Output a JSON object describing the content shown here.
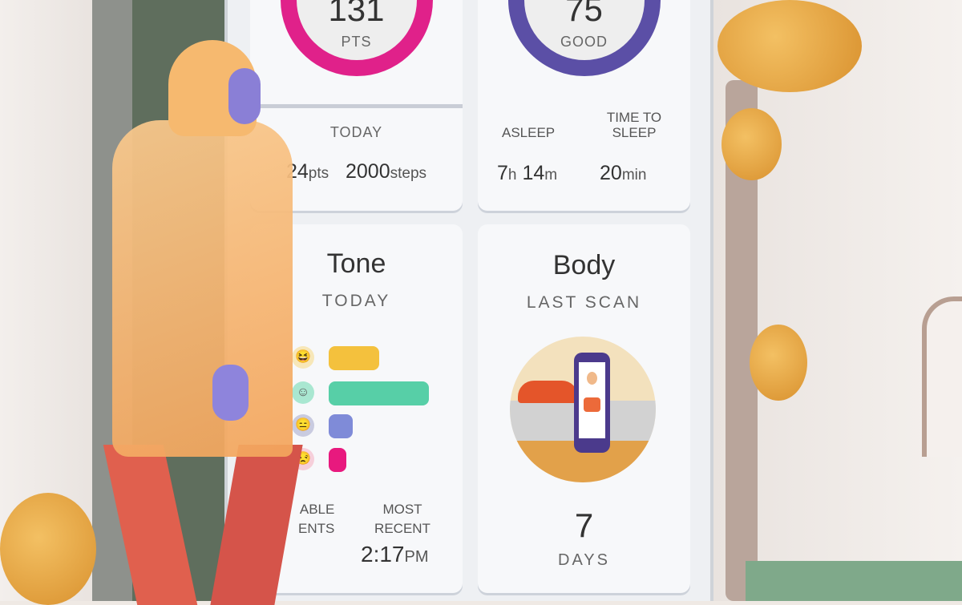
{
  "activity": {
    "score": "131",
    "unit": "PTS",
    "period": "TODAY",
    "pts_value": "24",
    "pts_unit": "pts",
    "steps_value": "2000",
    "steps_unit": "steps",
    "ring_color": "#e0218a"
  },
  "sleep": {
    "score": "75",
    "rating": "GOOD",
    "asleep_label": "ASLEEP",
    "asleep_h": "7",
    "asleep_h_unit": "h",
    "asleep_m": "14",
    "asleep_m_unit": "m",
    "time_to_sleep_label": "TIME TO SLEEP",
    "time_to_sleep_value": "20",
    "time_to_sleep_unit": "min",
    "ring_color": "#5b4fa6"
  },
  "tone": {
    "title": "Tone",
    "period": "TODAY",
    "bars": [
      {
        "mood": "very-positive",
        "value": 0.5,
        "color": "#f4c13d"
      },
      {
        "mood": "positive",
        "value": 1.0,
        "color": "#57cfa7"
      },
      {
        "mood": "neutral",
        "value": 0.24,
        "color": "#7f8bd8"
      },
      {
        "mood": "negative",
        "value": 0.17,
        "color": "#e8197e"
      }
    ],
    "notable_label_line1": "ABLE",
    "notable_label_line2": "ENTS",
    "recent_label": "MOST RECENT",
    "recent_time": "2:17",
    "recent_ampm": "PM"
  },
  "body": {
    "title": "Body",
    "subtitle": "LAST SCAN",
    "days_value": "7",
    "days_label": "DAYS"
  }
}
